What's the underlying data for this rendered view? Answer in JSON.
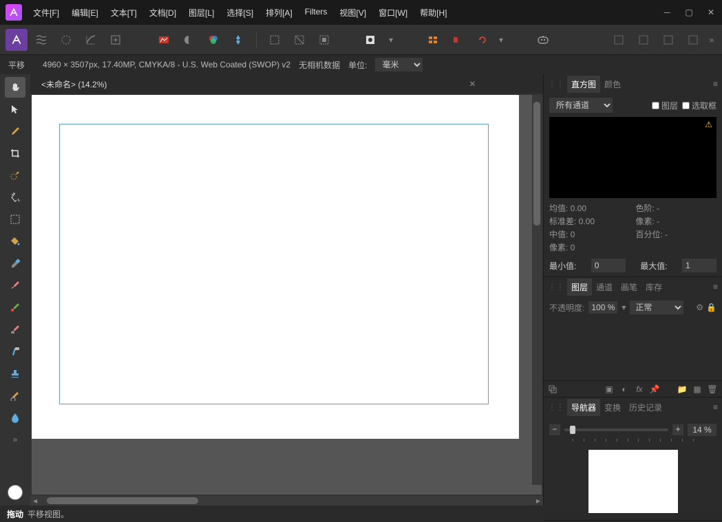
{
  "menus": [
    "文件[F]",
    "编辑[E]",
    "文本[T]",
    "文档[D]",
    "图层[L]",
    "选择[S]",
    "排列[A]",
    "Filters",
    "视图[V]",
    "窗口[W]",
    "帮助[H]"
  ],
  "info": {
    "tool": "平移",
    "docinfo": "4960 × 3507px, 17.40MP, CMYKA/8 - U.S. Web Coated (SWOP) v2",
    "camera": "无相机数据",
    "unit_label": "单位:",
    "unit_value": "毫米"
  },
  "doc": {
    "title": "<未命名> (14.2%)"
  },
  "histogram": {
    "tabs": [
      "直方图",
      "颜色"
    ],
    "channel": "所有通道",
    "check_layer": "图层",
    "check_marquee": "选取框",
    "stats": {
      "mean_l": "均值: 0.00",
      "chroma_l": "色阶: -",
      "std_l": "标准差: 0.00",
      "pixels_l": "像素: -",
      "median_l": "中值: 0",
      "pct_l": "百分位: -",
      "px_l": "像素: 0"
    },
    "min_label": "最小值:",
    "min_val": "0",
    "max_label": "最大值:",
    "max_val": "1"
  },
  "layers": {
    "tabs": [
      "图层",
      "通道",
      "画笔",
      "库存"
    ],
    "opacity_label": "不透明度:",
    "opacity_val": "100 %",
    "blend": "正常"
  },
  "navigator": {
    "tabs": [
      "导航器",
      "变换",
      "历史记录"
    ],
    "zoom": "14 %"
  },
  "status": {
    "action": "拖动",
    "hint": "平移视图。"
  }
}
